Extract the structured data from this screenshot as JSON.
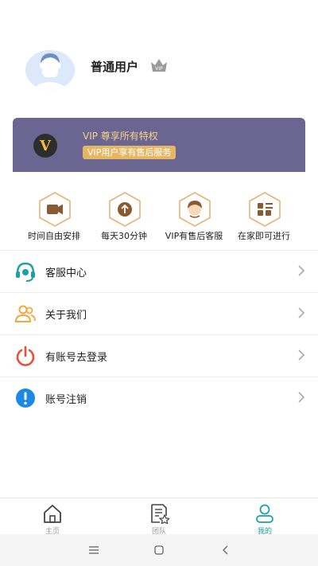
{
  "profile": {
    "username": "普通用户",
    "badge_icon": "vip-crown-icon",
    "badge_text": "VIP"
  },
  "vip": {
    "logo_letter": "V",
    "title": "VIP 尊享所有特权",
    "subtitle": "VIP用户享有售后服务",
    "colors": {
      "banner": "#6a6691",
      "gold": "#e5b764"
    }
  },
  "features": [
    {
      "label": "时间自由安排",
      "icon": "video-camera-icon"
    },
    {
      "label": "每天30分钟",
      "icon": "upload-arrow-icon"
    },
    {
      "label": "VIP有售后客服",
      "icon": "support-agent-icon"
    },
    {
      "label": "在家即可进行",
      "icon": "grid-menu-icon"
    }
  ],
  "menu": [
    {
      "label": "客服中心",
      "icon": "headset-icon",
      "color": "#1aa0a6"
    },
    {
      "label": "关于我们",
      "icon": "users-icon",
      "color": "#f3a73c"
    },
    {
      "label": "有账号去登录",
      "icon": "power-icon",
      "color": "#e94e3e"
    },
    {
      "label": "账号注销",
      "icon": "alert-icon",
      "color": "#1e88e5"
    }
  ],
  "bottom_nav": [
    {
      "label": "主页",
      "icon": "home-icon",
      "active": false
    },
    {
      "label": "团队",
      "icon": "document-star-icon",
      "active": false
    },
    {
      "label": "我的",
      "icon": "profile-icon",
      "active": true
    }
  ],
  "system_nav": [
    "menu-icon",
    "home-square-icon",
    "back-icon"
  ]
}
